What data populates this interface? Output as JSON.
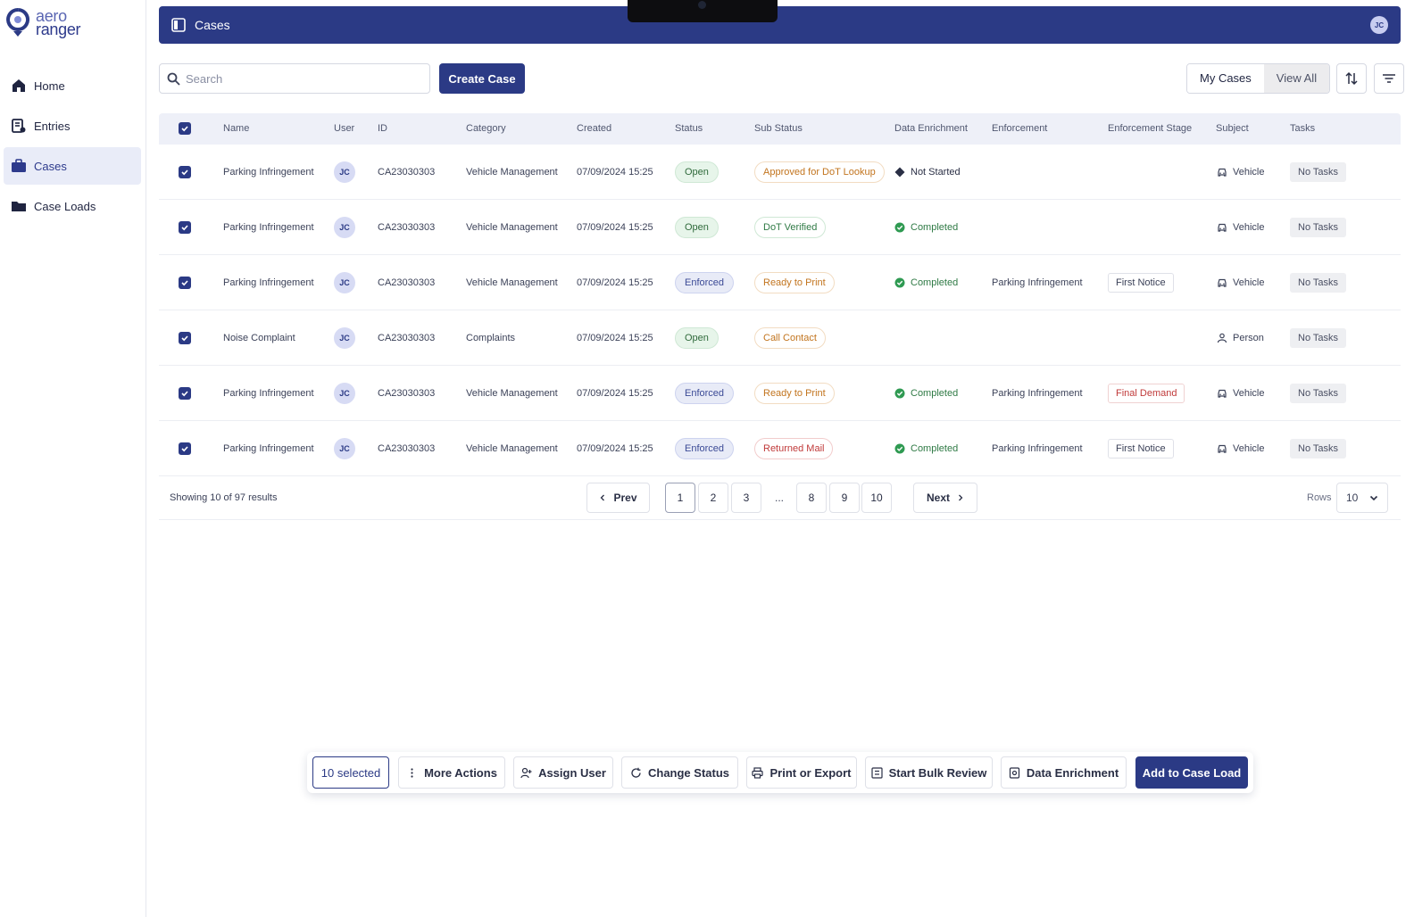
{
  "brand": {
    "line1": "aero",
    "line2": "ranger"
  },
  "nav": [
    {
      "label": "Home",
      "icon": "home-icon"
    },
    {
      "label": "Entries",
      "icon": "entries-icon"
    },
    {
      "label": "Cases",
      "icon": "briefcase-icon",
      "active": true
    },
    {
      "label": "Case Loads",
      "icon": "folder-icon"
    }
  ],
  "topbar": {
    "title": "Cases",
    "user_initials": "JC"
  },
  "toolbar": {
    "search_placeholder": "Search",
    "create_label": "Create Case",
    "my_cases_label": "My Cases",
    "view_all_label": "View All"
  },
  "table": {
    "headers": [
      "Name",
      "User",
      "ID",
      "Category",
      "Created",
      "Status",
      "Sub Status",
      "Data Enrichment",
      "Enforcement",
      "Enforcement Stage",
      "Subject",
      "Tasks"
    ],
    "rows": [
      {
        "name": "Parking Infringement",
        "user": "JC",
        "id": "CA23030303",
        "category": "Vehicle Management",
        "created": "07/09/2024 15:25",
        "status": "Open",
        "status_kind": "open",
        "sub_status": "Approved for DoT Lookup",
        "sub_kind": "orange",
        "enrichment": "Not Started",
        "enr_kind": "ns",
        "enforcement": "",
        "stage": "",
        "stage_kind": "",
        "subject": "Vehicle",
        "subject_icon": "car-icon",
        "tasks": "No Tasks"
      },
      {
        "name": "Parking Infringement",
        "user": "JC",
        "id": "CA23030303",
        "category": "Vehicle Management",
        "created": "07/09/2024 15:25",
        "status": "Open",
        "status_kind": "open",
        "sub_status": "DoT Verified",
        "sub_kind": "green",
        "enrichment": "Completed",
        "enr_kind": "done",
        "enforcement": "",
        "stage": "",
        "stage_kind": "",
        "subject": "Vehicle",
        "subject_icon": "car-icon",
        "tasks": "No Tasks"
      },
      {
        "name": "Parking Infringement",
        "user": "JC",
        "id": "CA23030303",
        "category": "Vehicle Management",
        "created": "07/09/2024 15:25",
        "status": "Enforced",
        "status_kind": "enforced",
        "sub_status": "Ready to Print",
        "sub_kind": "orange",
        "enrichment": "Completed",
        "enr_kind": "done",
        "enforcement": "Parking Infringement",
        "stage": "First Notice",
        "stage_kind": "",
        "subject": "Vehicle",
        "subject_icon": "car-icon",
        "tasks": "No Tasks"
      },
      {
        "name": "Noise Complaint",
        "user": "JC",
        "id": "CA23030303",
        "category": "Complaints",
        "created": "07/09/2024 15:25",
        "status": "Open",
        "status_kind": "open",
        "sub_status": "Call Contact",
        "sub_kind": "orange",
        "enrichment": "",
        "enr_kind": "",
        "enforcement": "",
        "stage": "",
        "stage_kind": "",
        "subject": "Person",
        "subject_icon": "person-icon",
        "tasks": "No Tasks"
      },
      {
        "name": "Parking Infringement",
        "user": "JC",
        "id": "CA23030303",
        "category": "Vehicle Management",
        "created": "07/09/2024 15:25",
        "status": "Enforced",
        "status_kind": "enforced",
        "sub_status": "Ready to Print",
        "sub_kind": "orange",
        "enrichment": "Completed",
        "enr_kind": "done",
        "enforcement": "Parking Infringement",
        "stage": "Final Demand",
        "stage_kind": "red",
        "subject": "Vehicle",
        "subject_icon": "car-icon",
        "tasks": "No Tasks"
      },
      {
        "name": "Parking Infringement",
        "user": "JC",
        "id": "CA23030303",
        "category": "Vehicle Management",
        "created": "07/09/2024 15:25",
        "status": "Enforced",
        "status_kind": "enforced",
        "sub_status": "Returned Mail",
        "sub_kind": "red",
        "enrichment": "Completed",
        "enr_kind": "done",
        "enforcement": "Parking Infringement",
        "stage": "First Notice",
        "stage_kind": "",
        "subject": "Vehicle",
        "subject_icon": "car-icon",
        "tasks": "No Tasks"
      }
    ]
  },
  "pagination": {
    "showing": "Showing 10 of 97 results",
    "prev": "Prev",
    "next": "Next",
    "pages": [
      "1",
      "2",
      "3",
      "...",
      "8",
      "9",
      "10"
    ],
    "current": "1",
    "rows_label": "Rows",
    "rows_value": "10"
  },
  "bulk": {
    "selected": "10 selected",
    "more_actions": "More Actions",
    "assign_user": "Assign User",
    "change_status": "Change Status",
    "print_export": "Print or Export",
    "bulk_review": "Start Bulk Review",
    "data_enrichment": "Data Enrichment",
    "add_case_load": "Add to Case Load"
  },
  "colors": {
    "primary": "#2b3a85",
    "open": "#2f6a3b",
    "completed": "#2f7a45",
    "warning": "#c2741e",
    "danger": "#c03a3a"
  }
}
